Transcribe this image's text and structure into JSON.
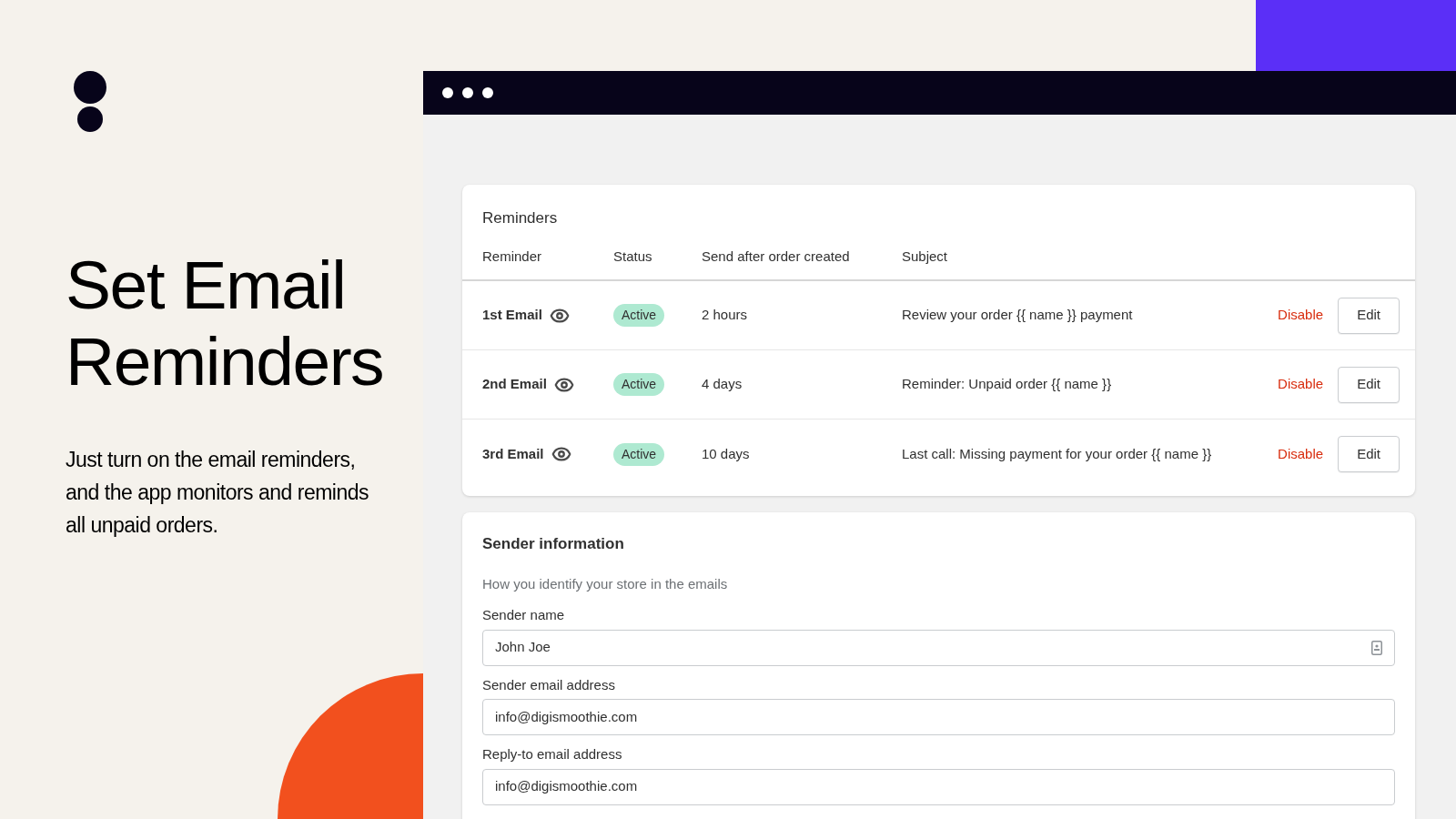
{
  "hero": {
    "title": "Set Email Reminders",
    "description": "Just turn on the email reminders, and the app monitors and reminds all unpaid orders."
  },
  "reminders": {
    "title": "Reminders",
    "columns": [
      "Reminder",
      "Status",
      "Send after order created",
      "Subject"
    ],
    "rows": [
      {
        "name": "1st Email",
        "status": "Active",
        "delay": "2 hours",
        "subject": "Review your order {{ name }} payment",
        "action": "Disable",
        "edit": "Edit"
      },
      {
        "name": "2nd Email",
        "status": "Active",
        "delay": "4 days",
        "subject": "Reminder: Unpaid order {{ name }}",
        "action": "Disable",
        "edit": "Edit"
      },
      {
        "name": "3rd Email",
        "status": "Active",
        "delay": "10 days",
        "subject": "Last call: Missing payment for your order {{ name }}",
        "action": "Disable",
        "edit": "Edit"
      }
    ]
  },
  "sender": {
    "title": "Sender information",
    "description": "How you identify your store in the emails",
    "fields": [
      {
        "label": "Sender name",
        "value": "John Joe",
        "kind": "contact"
      },
      {
        "label": "Sender email address",
        "value": "info@digismoothie.com",
        "kind": "plain"
      },
      {
        "label": "Reply-to email address",
        "value": "info@digismoothie.com",
        "kind": "plain"
      }
    ]
  }
}
